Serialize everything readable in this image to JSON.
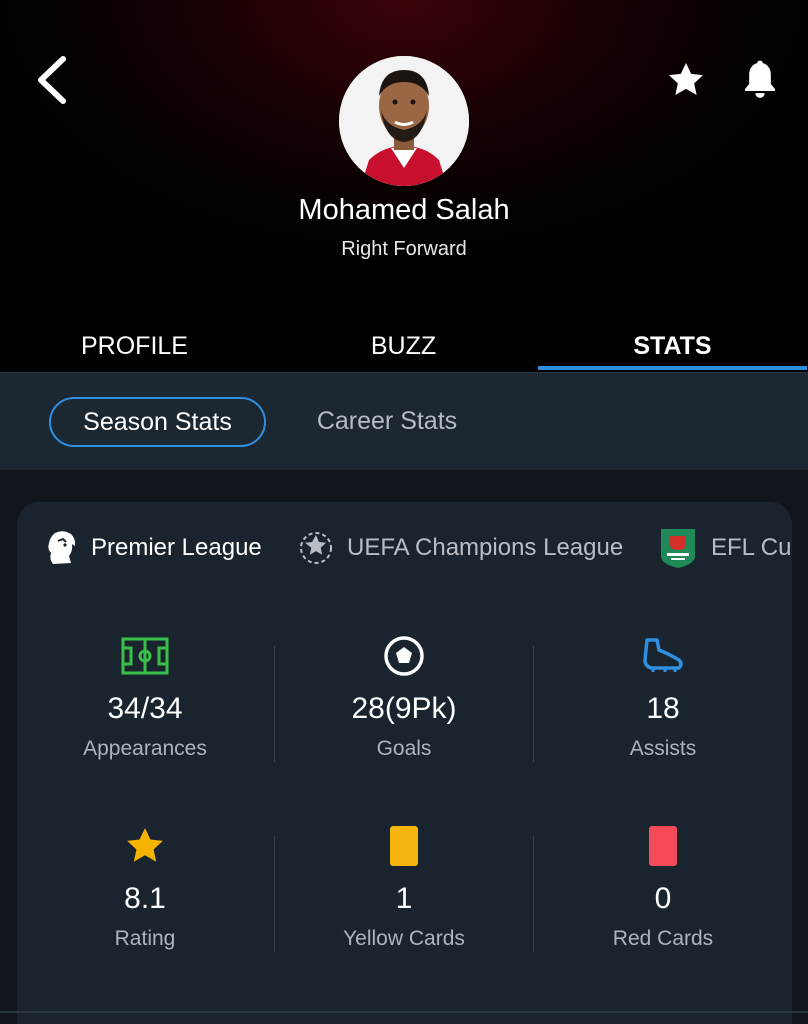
{
  "player": {
    "name": "Mohamed Salah",
    "position": "Right Forward"
  },
  "tabs": [
    {
      "label": "PROFILE",
      "active": false
    },
    {
      "label": "BUZZ",
      "active": false
    },
    {
      "label": "STATS",
      "active": true
    }
  ],
  "stats_mode": {
    "active": "Season Stats",
    "other": "Career Stats"
  },
  "competitions": [
    {
      "label": "Premier League",
      "icon": "premier-league-lion-icon",
      "active": true
    },
    {
      "label": "UEFA Champions League",
      "icon": "champions-league-ball-icon",
      "active": false
    },
    {
      "label": "EFL Cu",
      "icon": "carabao-cup-icon",
      "active": false
    }
  ],
  "stats": [
    {
      "value": "34/34",
      "label": "Appearances",
      "icon": "pitch-icon"
    },
    {
      "value": "28(9Pk)",
      "label": "Goals",
      "icon": "football-icon"
    },
    {
      "value": "18",
      "label": "Assists",
      "icon": "boot-icon"
    },
    {
      "value": "8.1",
      "label": "Rating",
      "icon": "star-icon"
    },
    {
      "value": "1",
      "label": "Yellow Cards",
      "icon": "yellow-card-icon"
    },
    {
      "value": "0",
      "label": "Red Cards",
      "icon": "red-card-icon"
    }
  ],
  "colors": {
    "accent": "#2b8fe0",
    "pitch": "#3cbf4a",
    "boot": "#2f8fe0",
    "star": "#f5b400",
    "yellow_card": "#f6b40e",
    "red_card": "#f44b57"
  }
}
